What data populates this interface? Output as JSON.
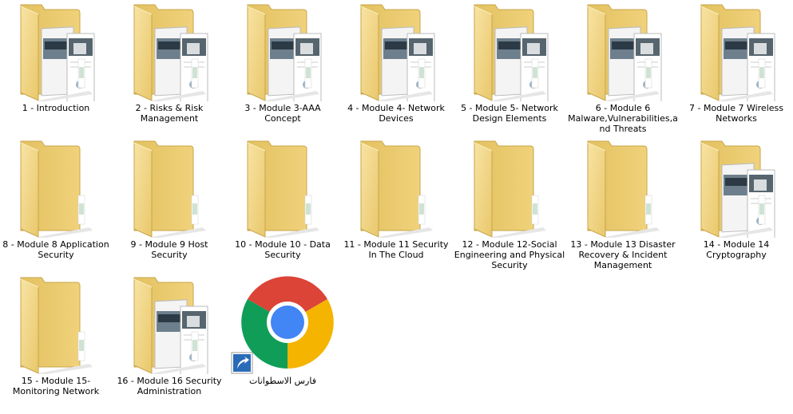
{
  "items": [
    {
      "label": "1 - Introduction",
      "icon": "folder-with-documents-icon",
      "docs": true
    },
    {
      "label": "2 - Risks & Risk Management",
      "icon": "folder-with-documents-icon",
      "docs": true
    },
    {
      "label": "3 - Module 3-AAA Concept",
      "icon": "folder-with-documents-icon",
      "docs": true
    },
    {
      "label": "4 - Module 4- Network Devices",
      "icon": "folder-with-documents-icon",
      "docs": true
    },
    {
      "label": "5 - Module 5- Network Design Elements",
      "icon": "folder-with-documents-icon",
      "docs": true
    },
    {
      "label": "6 - Module 6 Malware,Vulnerabilities,and Threats",
      "icon": "folder-with-documents-icon",
      "docs": true
    },
    {
      "label": "7 - Module 7 Wireless Networks",
      "icon": "folder-with-documents-icon",
      "docs": true
    },
    {
      "label": "8 - Module 8 Application Security",
      "icon": "folder-icon",
      "docs": false
    },
    {
      "label": "9 - Module 9 Host Security",
      "icon": "folder-icon",
      "docs": false
    },
    {
      "label": "10 - Module 10 - Data Security",
      "icon": "folder-icon",
      "docs": false
    },
    {
      "label": "11 - Module 11 Security In The Cloud",
      "icon": "folder-icon",
      "docs": false
    },
    {
      "label": "12 - Module 12-Social Engineering and Physical Security",
      "icon": "folder-icon",
      "docs": false
    },
    {
      "label": "13 - Module 13 Disaster Recovery & Incident Management",
      "icon": "folder-icon",
      "docs": false
    },
    {
      "label": "14 - Module 14 Cryptography",
      "icon": "folder-with-documents-icon",
      "docs": true
    },
    {
      "label": "15 - Module 15-Monitoring Network",
      "icon": "folder-icon",
      "docs": false
    },
    {
      "label": "16 - Module 16 Security Administration",
      "icon": "folder-with-documents-icon",
      "docs": true
    },
    {
      "label": "فارس الاسطوانات",
      "icon": "chrome-shortcut-icon",
      "docs": false
    }
  ],
  "colors": {
    "folder_back": "#e8c867",
    "folder_front": "#f6dc8e",
    "chrome_red": "#db4437",
    "chrome_green": "#0f9d58",
    "chrome_yellow": "#f4b400",
    "chrome_blue": "#4285f4"
  }
}
